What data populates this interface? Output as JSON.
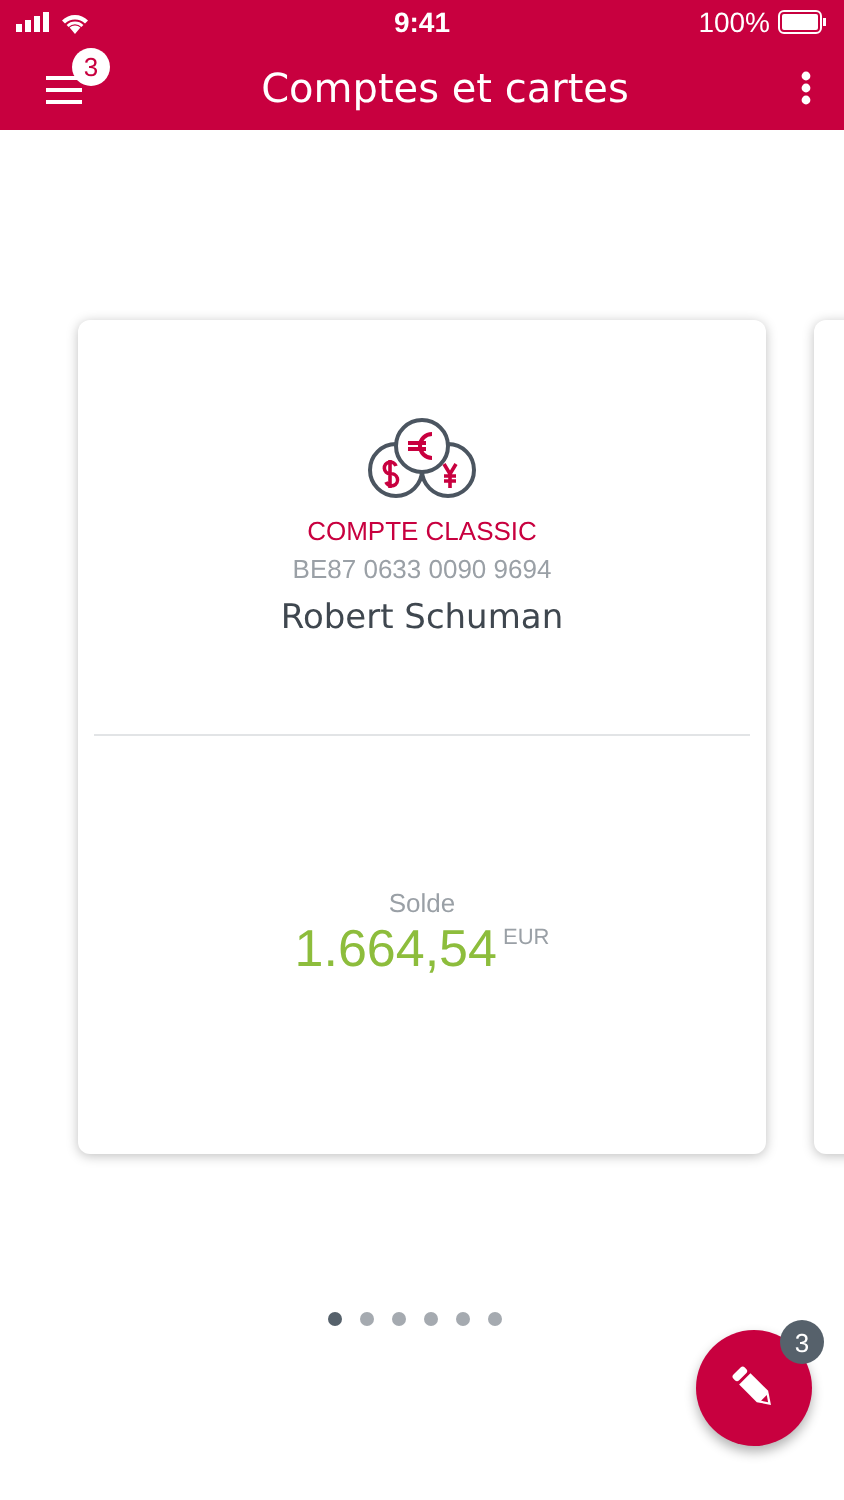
{
  "status_bar": {
    "time": "9:41",
    "battery": "100%"
  },
  "header": {
    "title": "Comptes et cartes",
    "menu_badge": "3"
  },
  "account": {
    "type": "COMPTE CLASSIC",
    "iban": "BE87 0633 0090 9694",
    "holder": "Robert Schuman",
    "balance_label": "Solde",
    "balance": "1.664,54",
    "currency": "EUR"
  },
  "pages": [
    {
      "selected": true
    },
    {
      "selected": false
    },
    {
      "selected": false
    },
    {
      "selected": false
    },
    {
      "selected": false
    },
    {
      "selected": false
    }
  ],
  "fab": {
    "badge": "3"
  }
}
